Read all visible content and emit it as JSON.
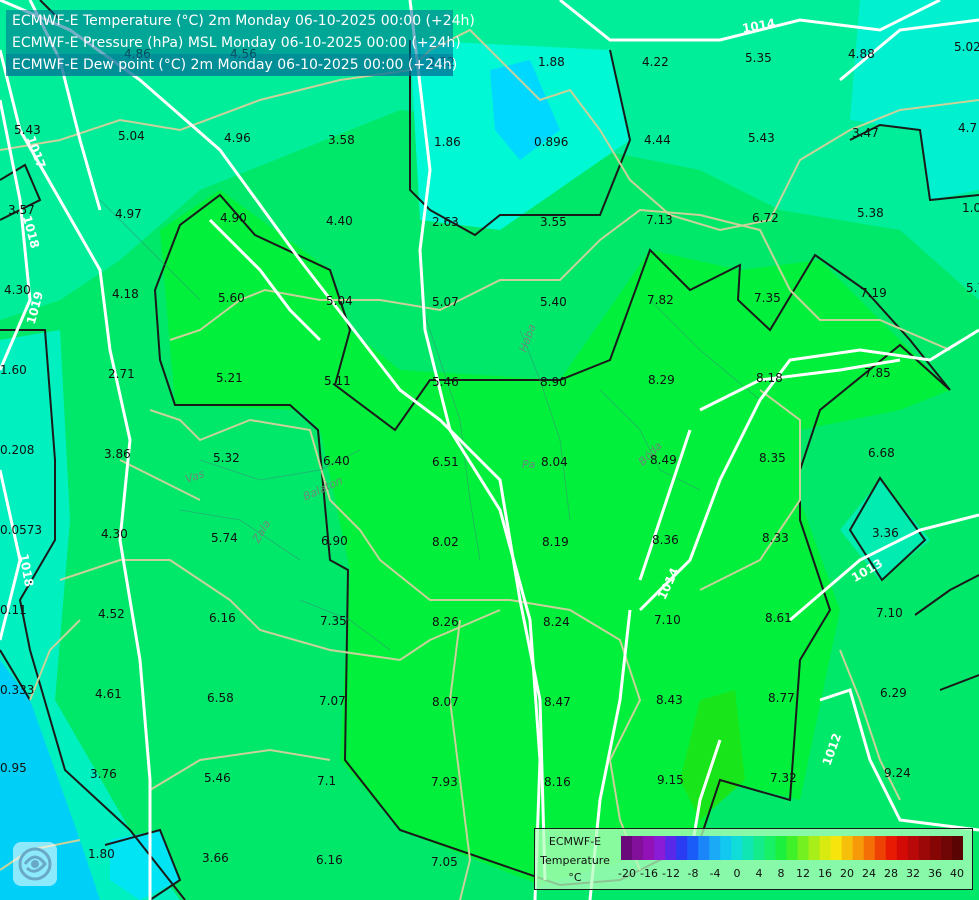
{
  "titles": [
    "ECMWF-E Temperature (°C) 2m Monday 06-10-2025 00:00 (+24h)",
    "ECMWF-E Pressure (hPa) MSL Monday 06-10-2025 00:00 (+24h)",
    "ECMWF-E Dew point (°C) 2m Monday 06-10-2025 00:00 (+24h)"
  ],
  "isobar_labels": [
    "1014",
    "1013",
    "1014",
    "1012",
    "1018",
    "1019",
    "1018",
    "1017"
  ],
  "rivers": [
    "Haba",
    "Bóda",
    "Vas",
    "Zala",
    "Pa",
    "Balaton"
  ],
  "values": [
    "5.02",
    "4.88",
    "5.35",
    "4.22",
    "1.88",
    "2.32",
    "4.86",
    "4.56",
    "4.7",
    "3.47",
    "5.43",
    "4.44",
    "0.896",
    "1.86",
    "3.58",
    "4.96",
    "5.04",
    "5.43",
    "1.0",
    "5.38",
    "6.72",
    "7.13",
    "3.55",
    "2.63",
    "4.40",
    "4.90",
    "4.97",
    "3.57",
    "5.7",
    "7.19",
    "7.35",
    "7.82",
    "5.40",
    "5.07",
    "5.04",
    "5.60",
    "4.18",
    "4.30",
    "7.85",
    "8.18",
    "8.29",
    "8.90",
    "5.46",
    "5.11",
    "5.21",
    "2.71",
    "1.60",
    "6.68",
    "8.35",
    "8.49",
    "8.04",
    "6.51",
    "6.40",
    "5.32",
    "3.86",
    "0.208",
    "3.36",
    "8.33",
    "8.36",
    "8.19",
    "8.02",
    "6.90",
    "5.74",
    "4.30",
    "0.0573",
    "7.10",
    "8.61",
    "7.10",
    "8.24",
    "8.26",
    "7.35",
    "6.16",
    "4.52",
    "0.11",
    "6.29",
    "8.77",
    "8.43",
    "8.47",
    "8.07",
    "7.07",
    "6.58",
    "4.61",
    "0.333",
    "9.24",
    "7.32",
    "9.15",
    "8.16",
    "7.93",
    "7.1",
    "5.46",
    "3.76",
    "0.95",
    "7.05",
    "6.16",
    "3.66",
    "1.80"
  ],
  "colorbar": {
    "title": "ECMWF-E",
    "variable": "Temperature",
    "unit": "°C",
    "ticks": [
      "-20",
      "-16",
      "-12",
      "-8",
      "-4",
      "0",
      "4",
      "8",
      "12",
      "16",
      "20",
      "24",
      "28",
      "32",
      "36",
      "40"
    ],
    "colors": [
      "#6a0a7a",
      "#83109a",
      "#9212b8",
      "#8a1bd6",
      "#5a28e8",
      "#2a3cf2",
      "#1a5cf8",
      "#1a86fa",
      "#1aaaf6",
      "#12c8f0",
      "#10dcd8",
      "#10e6b4",
      "#14ec8c",
      "#18f066",
      "#1cf03e",
      "#40f028",
      "#74f020",
      "#a8ee18",
      "#d8ea10",
      "#f6e40c",
      "#f6c00a",
      "#f69a0a",
      "#f47006",
      "#ee4204",
      "#e81a04",
      "#d40a06",
      "#b80808",
      "#9c0808",
      "#860606",
      "#700606",
      "#5a0404"
    ]
  },
  "colors": {
    "background": "#00e06a",
    "isobar": "#ffffff",
    "contour": "#1a1a1a",
    "border": "#c8d29a"
  }
}
